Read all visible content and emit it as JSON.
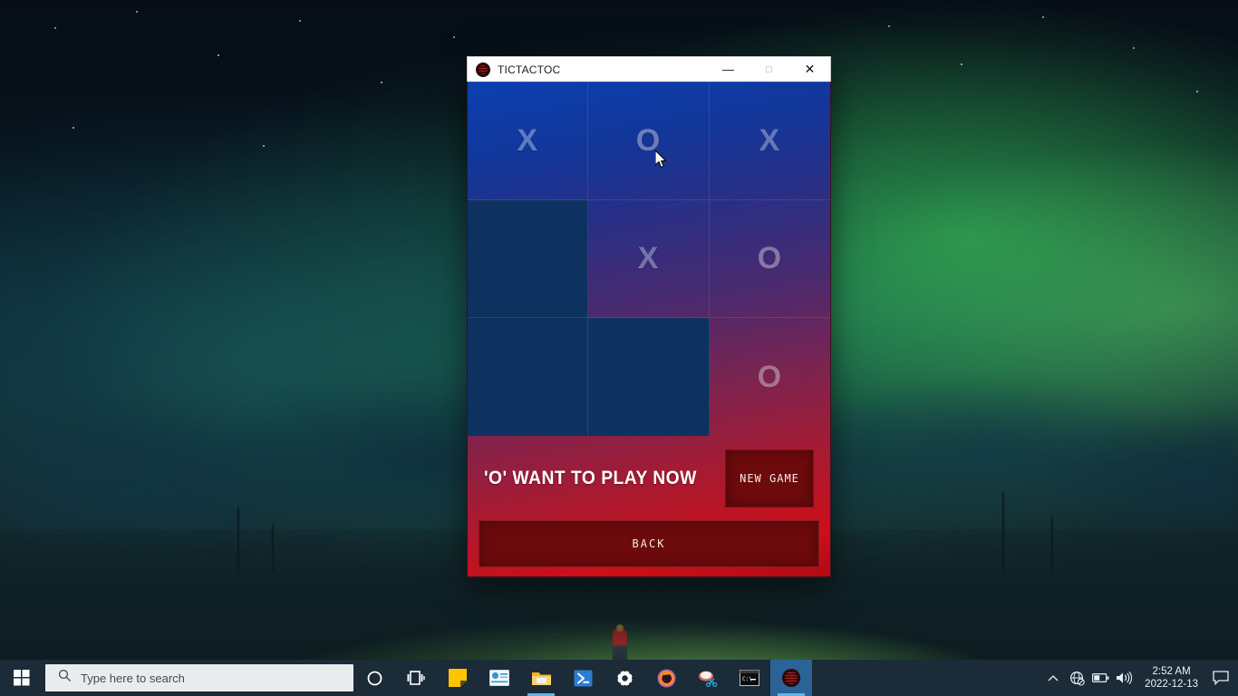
{
  "window": {
    "title": "TICTACTOC",
    "icon": "app-logo-icon",
    "controls": {
      "minimize": "—",
      "maximize": "□",
      "close": "✕"
    }
  },
  "game": {
    "board": [
      {
        "pos": "top-left",
        "mark": "X",
        "state": "filled"
      },
      {
        "pos": "top-center",
        "mark": "O",
        "state": "filled"
      },
      {
        "pos": "top-right",
        "mark": "X",
        "state": "filled"
      },
      {
        "pos": "middle-left",
        "mark": "",
        "state": "empty"
      },
      {
        "pos": "middle-center",
        "mark": "X",
        "state": "filled"
      },
      {
        "pos": "middle-right",
        "mark": "O",
        "state": "filled"
      },
      {
        "pos": "bottom-left",
        "mark": "",
        "state": "empty"
      },
      {
        "pos": "bottom-center",
        "mark": "",
        "state": "empty"
      },
      {
        "pos": "bottom-right",
        "mark": "O",
        "state": "filled"
      }
    ],
    "status_text": "'O' WANT TO PLAY NOW",
    "new_game_label": "NEW GAME",
    "back_label": "BACK",
    "colors": {
      "gradient_top": "#0b3fb0",
      "gradient_bottom": "#cc0f18",
      "empty_cell": "#0d3260",
      "button_fill": "#6d0a0c",
      "mark_color": "#dfe3ef"
    }
  },
  "taskbar": {
    "start_label": "start-button",
    "search_placeholder": "Type here to search",
    "apps": [
      {
        "name": "cortana",
        "label": "Cortana"
      },
      {
        "name": "task-view",
        "label": "Task View"
      },
      {
        "name": "sticky-notes",
        "label": "Sticky Notes"
      },
      {
        "name": "mail",
        "label": "Mail"
      },
      {
        "name": "file-explorer",
        "label": "File Explorer"
      },
      {
        "name": "powershell",
        "label": "Windows PowerShell"
      },
      {
        "name": "settings",
        "label": "Settings"
      },
      {
        "name": "music-player",
        "label": "Music Player"
      },
      {
        "name": "snipping-tool",
        "label": "Snipping Tool"
      },
      {
        "name": "command-prompt",
        "label": "Command Prompt"
      },
      {
        "name": "tictactoc",
        "label": "TICTACTOC"
      }
    ],
    "tray": {
      "show_hidden": "⌃",
      "network": "network-disconnected",
      "battery": "battery",
      "volume": "volume",
      "time": "2:52 AM",
      "date": "2022-12-13",
      "action_center": "action-center"
    }
  }
}
